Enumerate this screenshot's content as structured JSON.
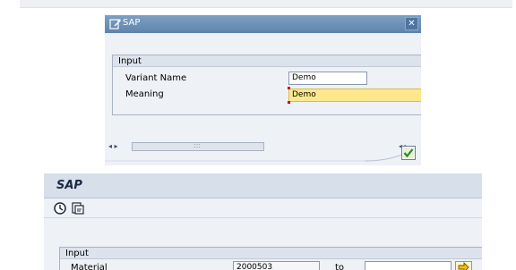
{
  "dialog": {
    "title": "SAP",
    "close_label": "✕",
    "group_title": "Input",
    "fields": [
      {
        "label": "Variant Name",
        "value": "Demo"
      },
      {
        "label": "Meaning",
        "value": "Demo"
      }
    ],
    "scroll": {
      "left_arrow": "◂ ▸",
      "right_arrow": "◂ ▸",
      "grip": ":::"
    }
  },
  "window": {
    "title": "SAP",
    "group_title": "Input",
    "material_label": "Material",
    "material_value": "2000503",
    "to_label": "to"
  },
  "colors": {
    "title_bar": "#6a8db5",
    "highlight_field": "#fde98c",
    "accent_red": "#d40000"
  }
}
